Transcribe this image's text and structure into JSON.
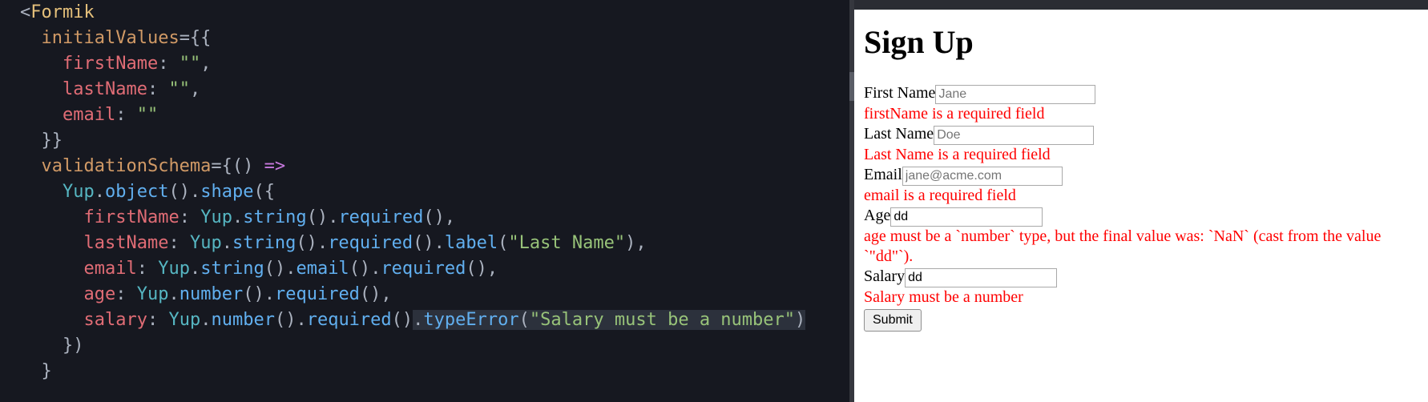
{
  "code": {
    "l1_tag": "Formik",
    "l2_attr": "initialValues",
    "l3_prop": "firstName",
    "l3_val": "\"\"",
    "l4_prop": "lastName",
    "l4_val": "\"\"",
    "l5_prop": "email",
    "l5_val": "\"\"",
    "l7_attr": "validationSchema",
    "l8_class": "Yup",
    "l8_m1": "object",
    "l8_m2": "shape",
    "l9_prop": "firstName",
    "l9_chain1": "string",
    "l9_chain2": "required",
    "l10_prop": "lastName",
    "l10_chain1": "string",
    "l10_chain2": "required",
    "l10_chain3": "label",
    "l10_arg": "\"Last Name\"",
    "l11_prop": "email",
    "l11_chain1": "string",
    "l11_chain2": "email",
    "l11_chain3": "required",
    "l12_prop": "age",
    "l12_chain1": "number",
    "l12_chain2": "required",
    "l13_prop": "salary",
    "l13_chain1": "number",
    "l13_chain2": "required",
    "l13_chain3": "typeError",
    "l13_arg": "\"Salary must be a number\""
  },
  "form": {
    "heading": "Sign Up",
    "firstName": {
      "label": "First Name",
      "placeholder": "Jane",
      "error": "firstName is a required field"
    },
    "lastName": {
      "label": "Last Name",
      "placeholder": "Doe",
      "error": "Last Name is a required field"
    },
    "email": {
      "label": "Email",
      "placeholder": "jane@acme.com",
      "error": "email is a required field"
    },
    "age": {
      "label": "Age",
      "value": "dd",
      "error": "age must be a `number` type, but the final value was: `NaN` (cast from the value `\"dd\"`)."
    },
    "salary": {
      "label": "Salary",
      "value": "dd",
      "error": "Salary must be a number"
    },
    "submit": "Submit"
  }
}
